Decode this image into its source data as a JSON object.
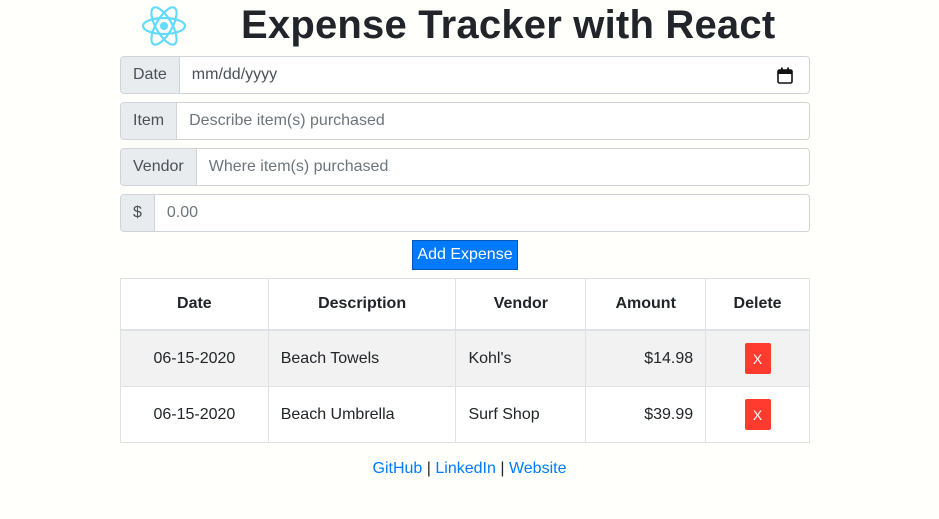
{
  "header": {
    "title": "Expense Tracker with React",
    "logo_icon": "react-logo-icon",
    "logo_color": "#61dafb"
  },
  "form": {
    "date": {
      "label": "Date",
      "placeholder": "mm/dd/yyyy",
      "icon": "calendar-icon"
    },
    "item": {
      "label": "Item",
      "placeholder": "Describe item(s) purchased"
    },
    "vendor": {
      "label": "Vendor",
      "placeholder": "Where item(s) purchased"
    },
    "amount": {
      "label": "$",
      "placeholder": "0.00"
    },
    "submit_label": "Add Expense"
  },
  "table": {
    "headers": [
      "Date",
      "Description",
      "Vendor",
      "Amount",
      "Delete"
    ],
    "rows": [
      {
        "date": "06-15-2020",
        "description": "Beach Towels",
        "vendor": "Kohl's",
        "amount": "$14.98",
        "delete_label": "X"
      },
      {
        "date": "06-15-2020",
        "description": "Beach Umbrella",
        "vendor": "Surf Shop",
        "amount": "$39.99",
        "delete_label": "X"
      }
    ]
  },
  "footer": {
    "links": [
      "GitHub",
      "LinkedIn",
      "Website"
    ],
    "separator": "|"
  },
  "colors": {
    "primary": "#007bff",
    "danger": "#ff3b2f",
    "stripe": "#f2f2f2"
  }
}
